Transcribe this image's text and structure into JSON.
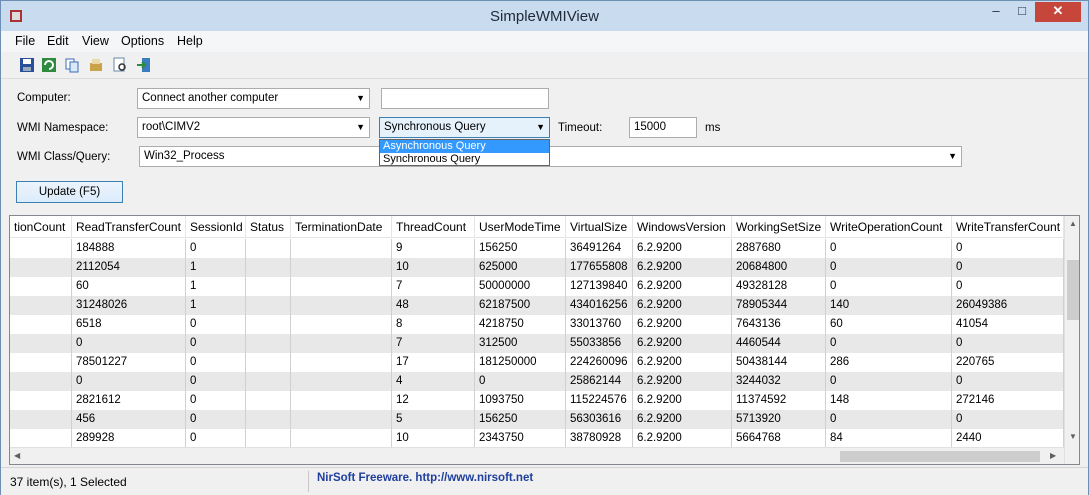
{
  "window": {
    "title": "SimpleWMIView",
    "min": "–",
    "max": "□",
    "close": "✕"
  },
  "menu": [
    "File",
    "Edit",
    "View",
    "Options",
    "Help"
  ],
  "toolbar": [
    "save-icon",
    "refresh-icon",
    "copy-icon",
    "properties-icon",
    "find-icon",
    "exit-icon"
  ],
  "form": {
    "computer_label": "Computer:",
    "computer_value": "Connect another computer",
    "computer_text": "",
    "namespace_label": "WMI Namespace:",
    "namespace_value": "root\\CIMV2",
    "query_mode_value": "Synchronous Query",
    "query_mode_options": [
      "Asynchronous Query",
      "Synchronous Query"
    ],
    "timeout_label": "Timeout:",
    "timeout_value": "15000",
    "timeout_unit": "ms",
    "class_label": "WMI Class/Query:",
    "class_value": "Win32_Process",
    "update_button": "Update (F5)"
  },
  "table": {
    "columns": [
      "tionCount",
      "ReadTransferCount",
      "SessionId",
      "Status",
      "TerminationDate",
      "ThreadCount",
      "UserModeTime",
      "VirtualSize",
      "WindowsVersion",
      "WorkingSetSize",
      "WriteOperationCount",
      "WriteTransferCount"
    ],
    "rows": [
      [
        "",
        "184888",
        "0",
        "",
        "",
        "9",
        "156250",
        "36491264",
        "6.2.9200",
        "2887680",
        "0",
        "0"
      ],
      [
        "",
        "2112054",
        "1",
        "",
        "",
        "10",
        "625000",
        "177655808",
        "6.2.9200",
        "20684800",
        "0",
        "0"
      ],
      [
        "",
        "60",
        "1",
        "",
        "",
        "7",
        "50000000",
        "127139840",
        "6.2.9200",
        "49328128",
        "0",
        "0"
      ],
      [
        "",
        "31248026",
        "1",
        "",
        "",
        "48",
        "62187500",
        "434016256",
        "6.2.9200",
        "78905344",
        "140",
        "26049386"
      ],
      [
        "",
        "6518",
        "0",
        "",
        "",
        "8",
        "4218750",
        "33013760",
        "6.2.9200",
        "7643136",
        "60",
        "41054"
      ],
      [
        "",
        "0",
        "0",
        "",
        "",
        "7",
        "312500",
        "55033856",
        "6.2.9200",
        "4460544",
        "0",
        "0"
      ],
      [
        "",
        "78501227",
        "0",
        "",
        "",
        "17",
        "181250000",
        "224260096",
        "6.2.9200",
        "50438144",
        "286",
        "220765"
      ],
      [
        "",
        "0",
        "0",
        "",
        "",
        "4",
        "0",
        "25862144",
        "6.2.9200",
        "3244032",
        "0",
        "0"
      ],
      [
        "",
        "2821612",
        "0",
        "",
        "",
        "12",
        "1093750",
        "115224576",
        "6.2.9200",
        "11374592",
        "148",
        "272146"
      ],
      [
        "",
        "456",
        "0",
        "",
        "",
        "5",
        "156250",
        "56303616",
        "6.2.9200",
        "5713920",
        "0",
        "0"
      ],
      [
        "",
        "289928",
        "0",
        "",
        "",
        "10",
        "2343750",
        "38780928",
        "6.2.9200",
        "5664768",
        "84",
        "2440"
      ]
    ]
  },
  "status": {
    "count": "37 item(s), 1 Selected",
    "link": "NirSoft Freeware.  http://www.nirsoft.net"
  }
}
